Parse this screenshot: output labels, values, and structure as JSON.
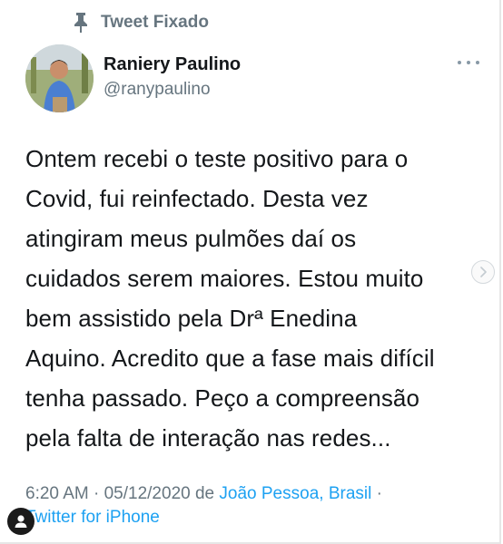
{
  "pinned": {
    "label": "Tweet Fixado",
    "icon": "pin-icon"
  },
  "author": {
    "name": "Raniery Paulino",
    "handle": "@ranypaulino"
  },
  "tweet": {
    "text": "Ontem recebi o teste positivo para o\nCovid, fui reinfectado. Desta vez\natingiram meus pulmões daí os\ncuidados serem maiores. Estou muito\nbem assistido pela Drª Enedina\nAquino. Acredito que a fase mais difícil\ntenha passado. Peço a compreensão\npela falta de interação nas redes..."
  },
  "meta": {
    "time": "6:20 AM",
    "sep1": " · ",
    "date": "05/12/2020",
    "de": " de ",
    "location": "João Pessoa, Brasil",
    "sep2": " ·",
    "source": "Twitter for iPhone"
  },
  "colors": {
    "link": "#1da1f2",
    "muted": "#66757f",
    "text": "#14171a"
  }
}
